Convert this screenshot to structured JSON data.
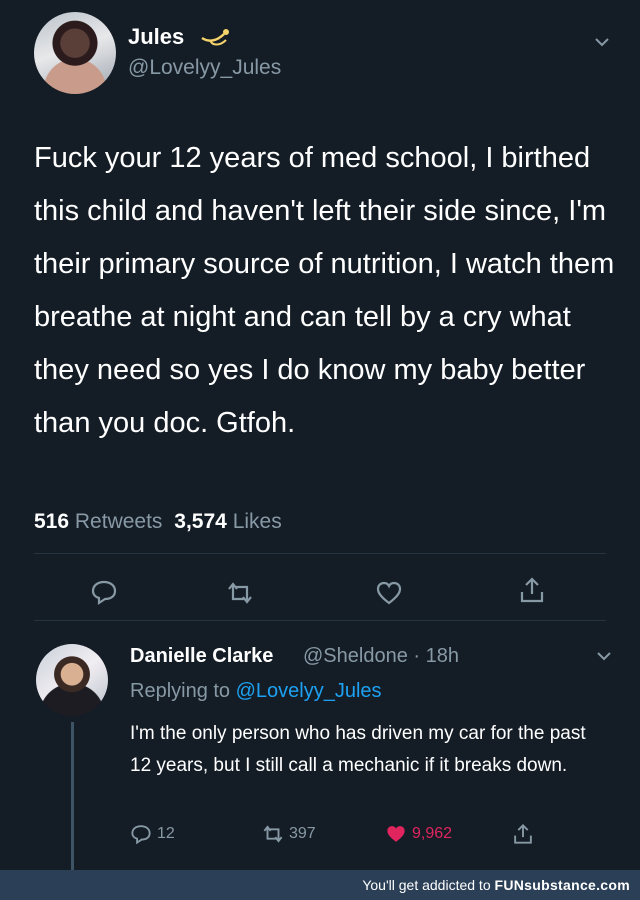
{
  "tweet": {
    "author_name": "Jules",
    "author_handle": "@Lovelyy_Jules",
    "text": "Fuck your 12 years of med school, I birthed this child and haven't left their side since, I'm their primary source of nutrition, I watch them breathe at night and can tell by a cry what they need so yes I do know my baby better than you doc. Gtfoh.",
    "retweets_count": "516",
    "retweets_label": "Retweets",
    "likes_count": "3,574",
    "likes_label": "Likes"
  },
  "reply": {
    "author_name": "Danielle Clarke",
    "author_handle": "@Sheldone",
    "time": "18h",
    "replying_prefix": "Replying to",
    "replying_to": "@Lovelyy_Jules",
    "text": "I'm the only person who has driven my car for the past 12 years, but I still call a mechanic if it breaks down.",
    "replies_count": "12",
    "retweets_count": "397",
    "likes_count": "9,962"
  },
  "footer": {
    "prefix": "You'll get addicted to",
    "brand": "FUNsubstance.com"
  },
  "colors": {
    "background": "#141d26",
    "secondary_text": "#8899a6",
    "link": "#1da1f2",
    "like": "#e0245e"
  },
  "icons": [
    "dove-icon",
    "chevron-down-icon",
    "reply-icon",
    "retweet-icon",
    "heart-icon",
    "share-icon"
  ]
}
